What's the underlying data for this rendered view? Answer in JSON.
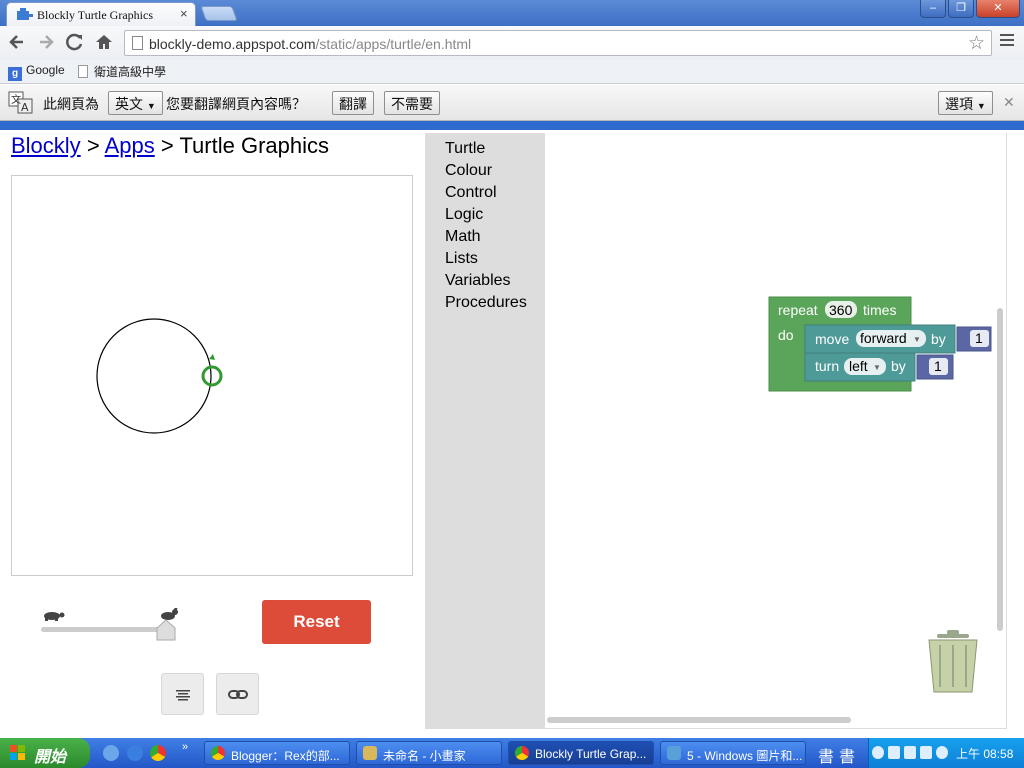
{
  "window": {
    "tab_title": "Blockly Turtle Graphics",
    "tab_close": "×",
    "controls": {
      "minimize": "–",
      "maximize": "❐",
      "close": "✕"
    }
  },
  "toolbar": {
    "url_host": "blockly-demo.appspot.com",
    "url_path": "/static/apps/turtle/en.html",
    "icons": [
      "back-arrow-icon",
      "forward-arrow-icon",
      "reload-icon",
      "home-icon",
      "star-icon",
      "menu-icon"
    ]
  },
  "bookmarks": {
    "google": "Google",
    "school": "衛道高級中學"
  },
  "infobar": {
    "prefix": "此網頁為",
    "language": "英文",
    "question": "您要翻譯網頁內容嗎？",
    "translate": "翻譯",
    "nope": "不需要",
    "options": "選項",
    "close": "✕"
  },
  "breadcrumb": {
    "blockly": "Blockly",
    "apps": "Apps",
    "current": "Turtle Graphics",
    "separator": ">"
  },
  "app": {
    "reset_label": "Reset",
    "accent": "#dd4b39"
  },
  "toolbox": [
    "Turtle",
    "Colour",
    "Control",
    "Logic",
    "Math",
    "Lists",
    "Variables",
    "Procedures"
  ],
  "blocks": {
    "repeat": {
      "label": "repeat",
      "count": "360",
      "times": "times",
      "do": "do",
      "color": "#5ba55b"
    },
    "move": {
      "label": "move",
      "direction": "forward",
      "by": "by",
      "value": "1",
      "color": "#4e9a98"
    },
    "turn": {
      "label": "turn",
      "direction": "left",
      "by": "by",
      "value": "1",
      "color": "#4e9a98"
    },
    "number_color": "#5b67a5"
  },
  "taskbar": {
    "start": "開始",
    "tasks": [
      {
        "label": "Blogger：Rex的部...",
        "active": false
      },
      {
        "label": "未命名 - 小畫家",
        "active": false
      },
      {
        "label": "Blockly Turtle Grap...",
        "active": true
      },
      {
        "label": "5 - Windows 圖片和...",
        "active": false
      }
    ],
    "ime1": "書",
    "ime2": "書",
    "clock": "上午 08:58"
  }
}
